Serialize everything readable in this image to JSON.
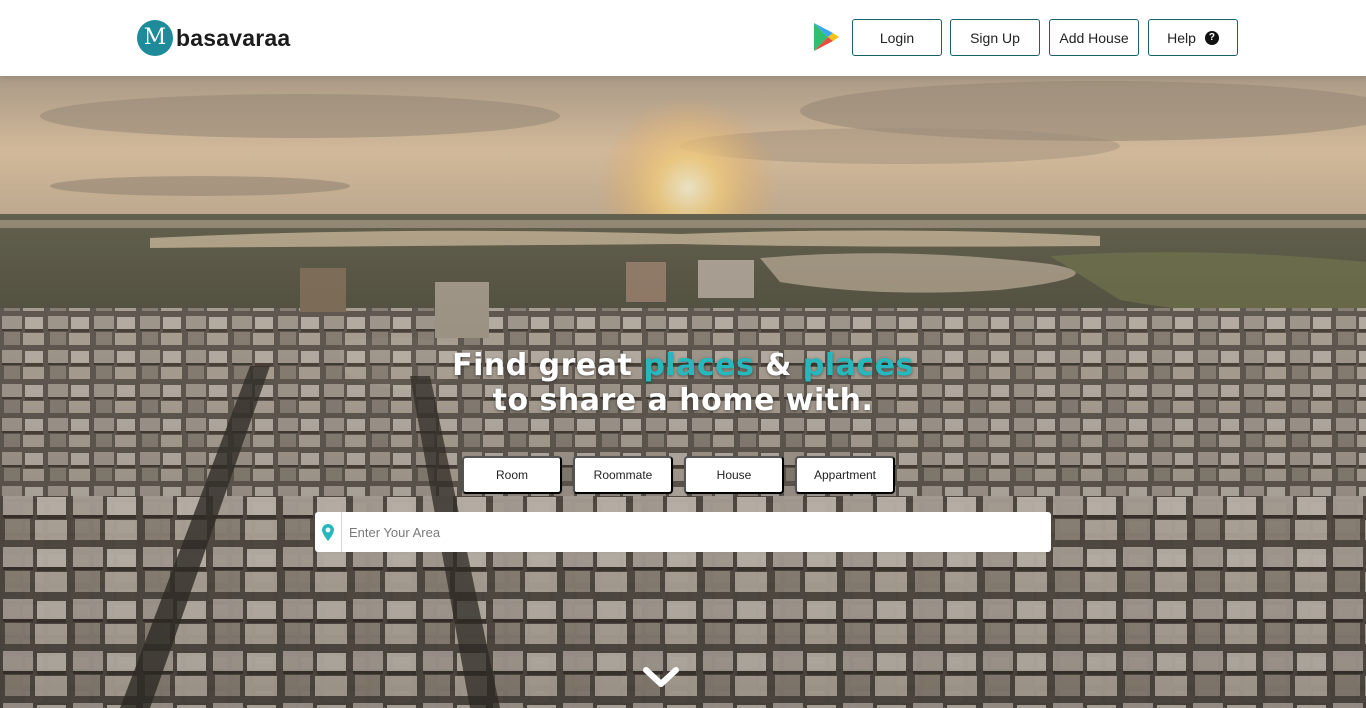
{
  "brand": {
    "logo_letter": "M",
    "name": "basavaraa"
  },
  "nav": {
    "login": "Login",
    "signup": "Sign Up",
    "add_house": "Add House",
    "help": "Help",
    "help_icon": "question-circle-icon",
    "app_store_icon": "google-play-icon"
  },
  "hero": {
    "headline_line1_part1": "Find great ",
    "headline_accent1": "places",
    "headline_line1_part2": " & ",
    "headline_accent2": "places",
    "headline_line2": "to share a home with.",
    "categories": [
      "Room",
      "Roommate",
      "House",
      "Appartment"
    ],
    "search": {
      "placeholder": "Enter Your Area",
      "value": "",
      "icon": "map-pin-icon"
    },
    "scroll_icon": "chevron-down-icon"
  },
  "colors": {
    "accent": "#27b8bd",
    "brand": "#1f8a99",
    "button_border": "#17616b"
  }
}
